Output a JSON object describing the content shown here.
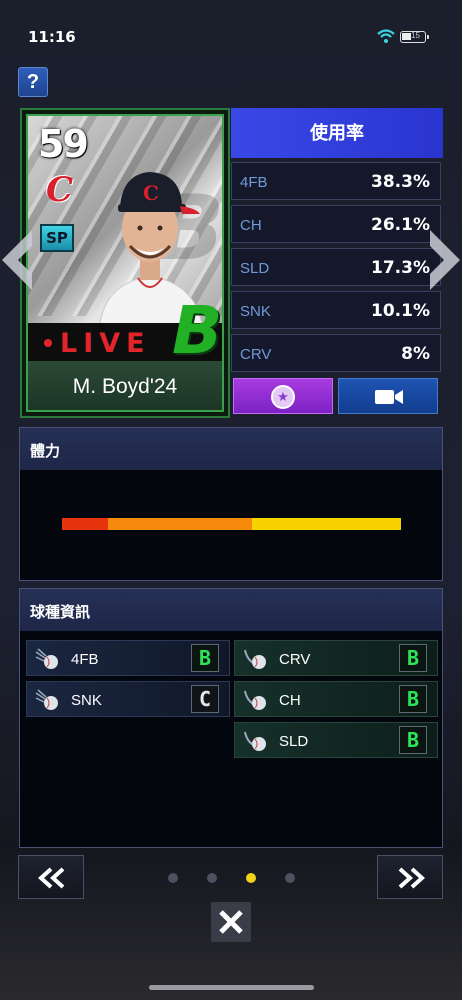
{
  "status_bar": {
    "time": "11:16",
    "battery_level": "15"
  },
  "help": {
    "label": "?"
  },
  "card": {
    "rating": "59",
    "team_logo": "C",
    "position": "SP",
    "live_label": "LIVE",
    "grade": "B",
    "player_name": "M. Boyd'24"
  },
  "usage": {
    "header": "使用率",
    "rows": [
      {
        "label": "4FB",
        "value": "38.3%"
      },
      {
        "label": "CH",
        "value": "26.1%"
      },
      {
        "label": "SLD",
        "value": "17.3%"
      },
      {
        "label": "SNK",
        "value": "10.1%"
      },
      {
        "label": "CRV",
        "value": "8%"
      }
    ],
    "buttons": [
      {
        "icon": "star-icon"
      },
      {
        "icon": "video-camera-icon"
      }
    ]
  },
  "stamina": {
    "title": "體力",
    "colors": [
      "#e8340e",
      "#f58a0c",
      "#f8d100"
    ],
    "segment_fractions": [
      0.135,
      0.425,
      0.44
    ]
  },
  "pitch_info": {
    "title": "球種資訊",
    "left_column": [
      {
        "label": "4FB",
        "grade": "B"
      },
      {
        "label": "SNK",
        "grade": "C"
      }
    ],
    "right_column": [
      {
        "label": "CRV",
        "grade": "B"
      },
      {
        "label": "CH",
        "grade": "B"
      },
      {
        "label": "SLD",
        "grade": "B"
      }
    ]
  },
  "pagination": {
    "total": 4,
    "active_index": 2
  },
  "colors": {
    "accent_blue": "#3948e6",
    "grade_green": "#2ee35a",
    "live_red": "#e2252b",
    "active_dot": "#f2d21a"
  }
}
